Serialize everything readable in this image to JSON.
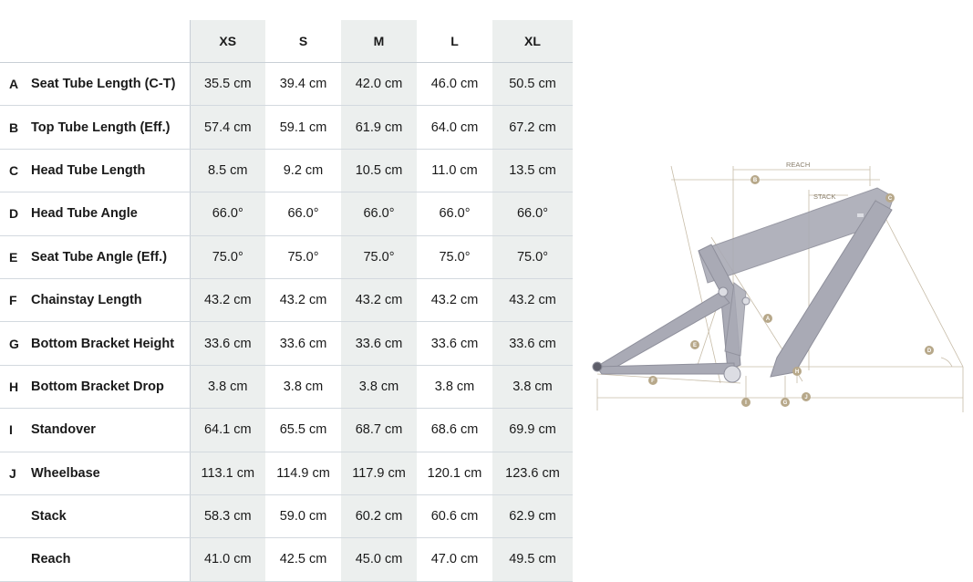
{
  "table": {
    "sizes": [
      "XS",
      "S",
      "M",
      "L",
      "XL"
    ],
    "rows": [
      {
        "letter": "A",
        "name": "Seat Tube Length (C-T)",
        "values": [
          "35.5 cm",
          "39.4 cm",
          "42.0 cm",
          "46.0 cm",
          "50.5 cm"
        ]
      },
      {
        "letter": "B",
        "name": "Top Tube Length (Eff.)",
        "values": [
          "57.4 cm",
          "59.1 cm",
          "61.9 cm",
          "64.0 cm",
          "67.2 cm"
        ]
      },
      {
        "letter": "C",
        "name": "Head Tube Length",
        "values": [
          "8.5 cm",
          "9.2 cm",
          "10.5 cm",
          "11.0 cm",
          "13.5 cm"
        ]
      },
      {
        "letter": "D",
        "name": "Head Tube Angle",
        "values": [
          "66.0°",
          "66.0°",
          "66.0°",
          "66.0°",
          "66.0°"
        ]
      },
      {
        "letter": "E",
        "name": "Seat Tube Angle (Eff.)",
        "values": [
          "75.0°",
          "75.0°",
          "75.0°",
          "75.0°",
          "75.0°"
        ]
      },
      {
        "letter": "F",
        "name": "Chainstay Length",
        "values": [
          "43.2 cm",
          "43.2 cm",
          "43.2 cm",
          "43.2 cm",
          "43.2 cm"
        ]
      },
      {
        "letter": "G",
        "name": "Bottom Bracket Height",
        "values": [
          "33.6 cm",
          "33.6 cm",
          "33.6 cm",
          "33.6 cm",
          "33.6 cm"
        ]
      },
      {
        "letter": "H",
        "name": "Bottom Bracket Drop",
        "values": [
          "3.8 cm",
          "3.8 cm",
          "3.8 cm",
          "3.8 cm",
          "3.8 cm"
        ]
      },
      {
        "letter": "I",
        "name": "Standover",
        "values": [
          "64.1 cm",
          "65.5 cm",
          "68.7 cm",
          "68.6 cm",
          "69.9 cm"
        ]
      },
      {
        "letter": "J",
        "name": "Wheelbase",
        "values": [
          "113.1 cm",
          "114.9 cm",
          "117.9 cm",
          "120.1 cm",
          "123.6 cm"
        ]
      },
      {
        "letter": "",
        "name": "Stack",
        "values": [
          "58.3 cm",
          "59.0 cm",
          "60.2 cm",
          "60.6 cm",
          "62.9 cm"
        ]
      },
      {
        "letter": "",
        "name": "Reach",
        "values": [
          "41.0 cm",
          "42.5 cm",
          "45.0 cm",
          "47.0 cm",
          "49.5 cm"
        ]
      }
    ]
  },
  "diagram": {
    "reach_label": "REACH",
    "stack_label": "STACK",
    "markers": [
      "A",
      "B",
      "C",
      "D",
      "E",
      "F",
      "G",
      "H",
      "I",
      "J"
    ],
    "frame_color": "#a9aab5",
    "dimension_color": "#b9a88c"
  }
}
